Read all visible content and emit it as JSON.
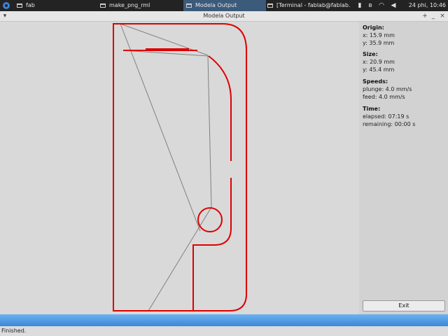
{
  "taskbar": {
    "items": [
      {
        "label": "fab",
        "active": false
      },
      {
        "label": "make_png_rml",
        "active": false
      },
      {
        "label": "Modela Output",
        "active": true
      },
      {
        "label": "[Terminal - fablab@fablab...",
        "active": false
      }
    ],
    "tray_icons": [
      "battery-icon",
      "bluetooth-icon",
      "wifi-icon",
      "volume-icon"
    ],
    "clock": "24 phi, 10:46"
  },
  "window": {
    "title": "Modela Output",
    "menu_icon": "chevron-down-icon",
    "controls": [
      "+",
      "_",
      "×"
    ]
  },
  "info": {
    "origin": {
      "heading": "Origin:",
      "x": "x: 15.9 mm",
      "y": "y: 35.9 mm"
    },
    "size": {
      "heading": "Size:",
      "x": "x: 20.9 mm",
      "y": "y: 45.4 mm"
    },
    "speeds": {
      "heading": "Speeds:",
      "plunge": "plunge: 4.0 mm/s",
      "feed": "feed: 4.0 mm/s"
    },
    "time": {
      "heading": "Time:",
      "elapsed": "elapsed: 07:19 s",
      "remaining": "remaining: 00:00 s"
    },
    "exit_label": "Exit"
  },
  "progress": {
    "value": 1.0
  },
  "status": {
    "text": "Finished."
  },
  "colors": {
    "cut_path": "#dd0000",
    "travel_path": "#808080",
    "progress": "#4a96e0",
    "taskbar": "#232323"
  }
}
